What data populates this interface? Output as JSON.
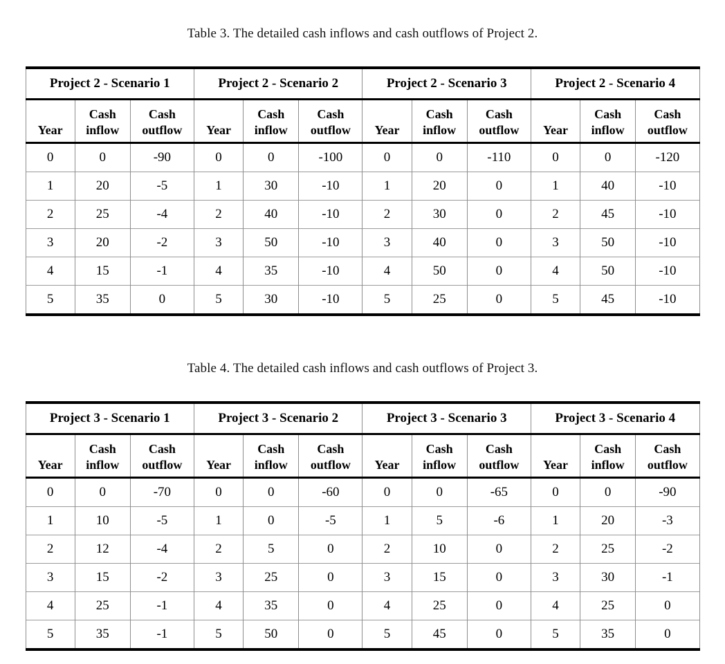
{
  "document": {
    "background_color": "#ffffff",
    "text_color": "#000000",
    "rule_color": "#000000",
    "grid_color": "#8c8c8c"
  },
  "tables": [
    {
      "caption": "Table 3. The detailed cash inflows and cash outflows of Project 2.",
      "groups": [
        {
          "title": "Project 2 - Scenario 1",
          "columns": [
            "Year",
            "Cash inflow",
            "Cash outflow"
          ],
          "column_lines": [
            [
              "Year"
            ],
            [
              "Cash",
              "inflow"
            ],
            [
              "Cash",
              "outflow"
            ]
          ],
          "rows": [
            [
              "0",
              "0",
              "-90"
            ],
            [
              "1",
              "20",
              "-5"
            ],
            [
              "2",
              "25",
              "-4"
            ],
            [
              "3",
              "20",
              "-2"
            ],
            [
              "4",
              "15",
              "-1"
            ],
            [
              "5",
              "35",
              "0"
            ]
          ]
        },
        {
          "title": "Project 2 - Scenario 2",
          "columns": [
            "Year",
            "Cash inflow",
            "Cash outflow"
          ],
          "column_lines": [
            [
              "Year"
            ],
            [
              "Cash",
              "inflow"
            ],
            [
              "Cash",
              "outflow"
            ]
          ],
          "rows": [
            [
              "0",
              "0",
              "-100"
            ],
            [
              "1",
              "30",
              "-10"
            ],
            [
              "2",
              "40",
              "-10"
            ],
            [
              "3",
              "50",
              "-10"
            ],
            [
              "4",
              "35",
              "-10"
            ],
            [
              "5",
              "30",
              "-10"
            ]
          ]
        },
        {
          "title": "Project 2 - Scenario 3",
          "columns": [
            "Year",
            "Cash inflow",
            "Cash outflow"
          ],
          "column_lines": [
            [
              "Year"
            ],
            [
              "Cash",
              "inflow"
            ],
            [
              "Cash",
              "outflow"
            ]
          ],
          "rows": [
            [
              "0",
              "0",
              "-110"
            ],
            [
              "1",
              "20",
              "0"
            ],
            [
              "2",
              "30",
              "0"
            ],
            [
              "3",
              "40",
              "0"
            ],
            [
              "4",
              "50",
              "0"
            ],
            [
              "5",
              "25",
              "0"
            ]
          ]
        },
        {
          "title": "Project 2 - Scenario 4",
          "columns": [
            "Year",
            "Cash inflow",
            "Cash outflow"
          ],
          "column_lines": [
            [
              "Year"
            ],
            [
              "Cash",
              "inflow"
            ],
            [
              "Cash",
              "outflow"
            ]
          ],
          "rows": [
            [
              "0",
              "0",
              "-120"
            ],
            [
              "1",
              "40",
              "-10"
            ],
            [
              "2",
              "45",
              "-10"
            ],
            [
              "3",
              "50",
              "-10"
            ],
            [
              "4",
              "50",
              "-10"
            ],
            [
              "5",
              "45",
              "-10"
            ]
          ]
        }
      ]
    },
    {
      "caption": "Table 4. The detailed cash inflows and cash outflows of Project 3.",
      "groups": [
        {
          "title": "Project 3 - Scenario 1",
          "columns": [
            "Year",
            "Cash inflow",
            "Cash outflow"
          ],
          "column_lines": [
            [
              "Year"
            ],
            [
              "Cash",
              "inflow"
            ],
            [
              "Cash",
              "outflow"
            ]
          ],
          "rows": [
            [
              "0",
              "0",
              "-70"
            ],
            [
              "1",
              "10",
              "-5"
            ],
            [
              "2",
              "12",
              "-4"
            ],
            [
              "3",
              "15",
              "-2"
            ],
            [
              "4",
              "25",
              "-1"
            ],
            [
              "5",
              "35",
              "-1"
            ]
          ]
        },
        {
          "title": "Project 3 - Scenario 2",
          "columns": [
            "Year",
            "Cash inflow",
            "Cash outflow"
          ],
          "column_lines": [
            [
              "Year"
            ],
            [
              "Cash",
              "inflow"
            ],
            [
              "Cash",
              "outflow"
            ]
          ],
          "rows": [
            [
              "0",
              "0",
              "-60"
            ],
            [
              "1",
              "0",
              "-5"
            ],
            [
              "2",
              "5",
              "0"
            ],
            [
              "3",
              "25",
              "0"
            ],
            [
              "4",
              "35",
              "0"
            ],
            [
              "5",
              "50",
              "0"
            ]
          ]
        },
        {
          "title": "Project 3 - Scenario 3",
          "columns": [
            "Year",
            "Cash inflow",
            "Cash outflow"
          ],
          "column_lines": [
            [
              "Year"
            ],
            [
              "Cash",
              "inflow"
            ],
            [
              "Cash",
              "outflow"
            ]
          ],
          "rows": [
            [
              "0",
              "0",
              "-65"
            ],
            [
              "1",
              "5",
              "-6"
            ],
            [
              "2",
              "10",
              "0"
            ],
            [
              "3",
              "15",
              "0"
            ],
            [
              "4",
              "25",
              "0"
            ],
            [
              "5",
              "45",
              "0"
            ]
          ]
        },
        {
          "title": "Project 3 - Scenario 4",
          "columns": [
            "Year",
            "Cash inflow",
            "Cash outflow"
          ],
          "column_lines": [
            [
              "Year"
            ],
            [
              "Cash",
              "inflow"
            ],
            [
              "Cash",
              "outflow"
            ]
          ],
          "rows": [
            [
              "0",
              "0",
              "-90"
            ],
            [
              "1",
              "20",
              "-3"
            ],
            [
              "2",
              "25",
              "-2"
            ],
            [
              "3",
              "30",
              "-1"
            ],
            [
              "4",
              "25",
              "0"
            ],
            [
              "5",
              "35",
              "0"
            ]
          ]
        }
      ]
    }
  ]
}
